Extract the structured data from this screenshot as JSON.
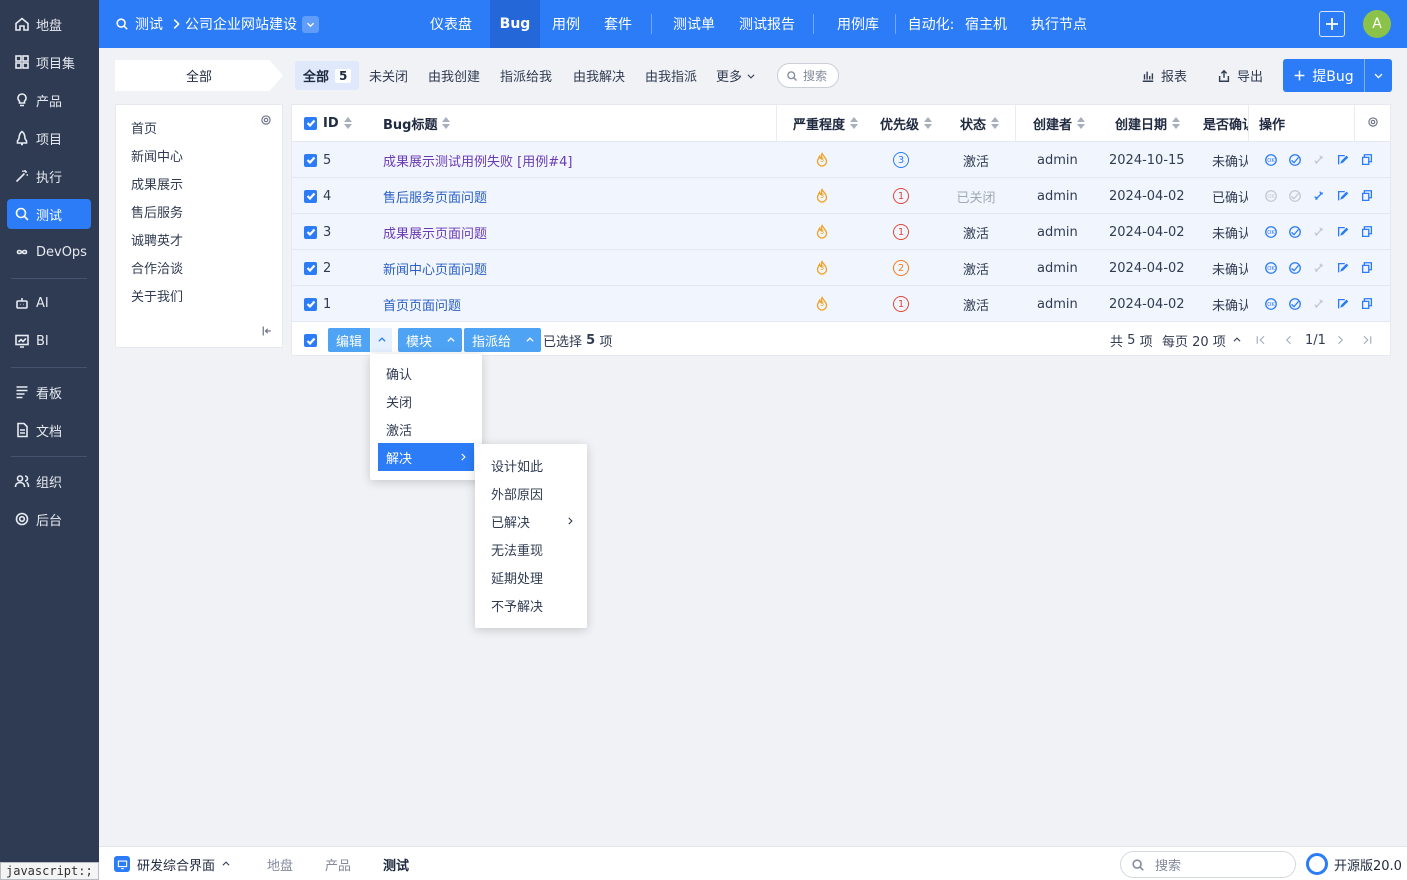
{
  "sidebar": {
    "items": [
      {
        "label": "地盘",
        "icon": "home-icon"
      },
      {
        "label": "项目集",
        "icon": "grid-icon"
      },
      {
        "label": "产品",
        "icon": "bulb-icon"
      },
      {
        "label": "项目",
        "icon": "rocket-icon"
      },
      {
        "label": "执行",
        "icon": "wand-icon"
      },
      {
        "label": "测试",
        "icon": "search-icon"
      },
      {
        "label": "DevOps",
        "icon": "infinity-icon"
      },
      {
        "label": "AI",
        "icon": "robot-icon"
      },
      {
        "label": "BI",
        "icon": "chart-icon"
      },
      {
        "label": "看板",
        "icon": "kanban-icon"
      },
      {
        "label": "文档",
        "icon": "document-icon"
      },
      {
        "label": "组织",
        "icon": "people-icon"
      },
      {
        "label": "后台",
        "icon": "gear-icon"
      }
    ],
    "active": "测试",
    "status_tip": "javascript:;"
  },
  "header": {
    "crumb_module": "测试",
    "crumb_product": "公司企业网站建设",
    "nav": [
      "仪表盘",
      "Bug",
      "用例",
      "套件",
      "测试单",
      "测试报告",
      "用例库",
      "自动化:",
      "宿主机",
      "执行节点"
    ],
    "nav_active": "Bug",
    "avatar": "A"
  },
  "filters": {
    "module_select": "全部",
    "tabs": [
      {
        "label": "全部",
        "count": "5"
      },
      {
        "label": "未关闭"
      },
      {
        "label": "由我创建"
      },
      {
        "label": "指派给我"
      },
      {
        "label": "由我解决"
      },
      {
        "label": "由我指派"
      },
      {
        "label": "更多"
      }
    ],
    "search_placeholder": "搜索",
    "report": "报表",
    "export": "导出",
    "create": "提Bug"
  },
  "tree": {
    "items": [
      "首页",
      "新闻中心",
      "成果展示",
      "售后服务",
      "诚聘英才",
      "合作洽谈",
      "关于我们"
    ]
  },
  "table": {
    "columns": [
      "ID",
      "Bug标题",
      "严重程度",
      "优先级",
      "状态",
      "创建者",
      "创建日期",
      "是否确认",
      "操作"
    ],
    "rows": [
      {
        "id": "5",
        "title": "成果展示测试用例失败 [用例#4]",
        "severity": "3",
        "priority": "3",
        "status": "激活",
        "creator": "admin",
        "date": "2024-10-15",
        "confirmed": "未确认"
      },
      {
        "id": "4",
        "title": "售后服务页面问题",
        "severity": "3",
        "priority": "1",
        "status": "已关闭",
        "creator": "admin",
        "date": "2024-04-02",
        "confirmed": "已确认"
      },
      {
        "id": "3",
        "title": "成果展示页面问题",
        "severity": "3",
        "priority": "1",
        "status": "激活",
        "creator": "admin",
        "date": "2024-04-02",
        "confirmed": "未确认"
      },
      {
        "id": "2",
        "title": "新闻中心页面问题",
        "severity": "3",
        "priority": "2",
        "status": "激活",
        "creator": "admin",
        "date": "2024-04-02",
        "confirmed": "未确认"
      },
      {
        "id": "1",
        "title": "首页页面问题",
        "severity": "3",
        "priority": "1",
        "status": "激活",
        "creator": "admin",
        "date": "2024-04-02",
        "confirmed": "未确认"
      }
    ],
    "batch": {
      "edit": "编辑",
      "module": "模块",
      "assign": "指派给",
      "selected_prefix": "已选择",
      "selected_count": "5",
      "selected_suffix": "项"
    },
    "pager": {
      "total_prefix": "共",
      "total": "5",
      "total_suffix": "项",
      "per_page": "每页 20 项",
      "page": "1/1"
    }
  },
  "edit_menu": {
    "items": [
      "确认",
      "关闭",
      "激活",
      "解决"
    ],
    "active": "解决"
  },
  "resolve_menu": {
    "items": [
      "设计如此",
      "外部原因",
      "已解决",
      "无法重现",
      "延期处理",
      "不予解决"
    ]
  },
  "bottombar": {
    "app_switch": "研发综合界面",
    "tabs": [
      "地盘",
      "产品",
      "测试"
    ],
    "current": "测试",
    "search_placeholder": "搜索",
    "version": "开源版20.0"
  },
  "colors": {
    "primary": "#2b7cf6",
    "sidebar": "#2f3b52",
    "severity": "#f0a020",
    "priority_1": "#e0463a",
    "priority_2": "#f07c1a",
    "priority_3": "#2b7cf6"
  }
}
